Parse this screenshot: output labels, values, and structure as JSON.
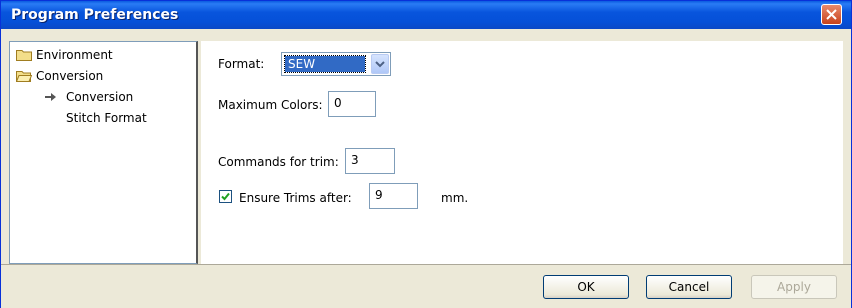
{
  "window": {
    "title": "Program Preferences"
  },
  "tree": {
    "items": [
      {
        "label": "Environment",
        "icon": "folder-icon"
      },
      {
        "label": "Conversion",
        "icon": "folder-open-icon"
      },
      {
        "label": "Conversion",
        "icon": "arrow-right-icon"
      },
      {
        "label": "Stitch Format",
        "icon": ""
      }
    ]
  },
  "form": {
    "format_label": "Format:",
    "format_value": "SEW",
    "max_colors_label": "Maximum Colors:",
    "max_colors_value": "0",
    "commands_trim_label": "Commands for trim:",
    "commands_trim_value": "3",
    "ensure_trims_label": "Ensure Trims after:",
    "ensure_trims_checked": true,
    "ensure_trims_value": "9",
    "ensure_trims_unit": "mm."
  },
  "buttons": {
    "ok": "OK",
    "cancel": "Cancel",
    "apply": "Apply"
  },
  "colors": {
    "titlebar": "#0a5be0",
    "close": "#c8421c",
    "selection": "#316ac5"
  }
}
